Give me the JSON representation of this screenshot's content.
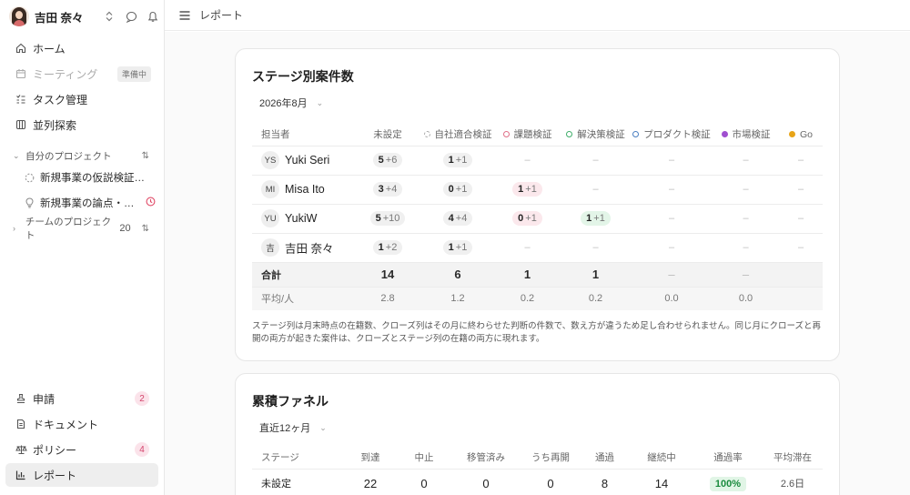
{
  "user": {
    "name": "吉田 奈々"
  },
  "nav": {
    "home": "ホーム",
    "meeting": "ミーティング",
    "meeting_badge": "準備中",
    "tasks": "タスク管理",
    "explore": "並列探索",
    "requests": "申請",
    "requests_count": "2",
    "documents": "ドキュメント",
    "policy": "ポリシー",
    "policy_count": "4",
    "reports": "レポート"
  },
  "my_projects": {
    "label": "自分のプロジェクト",
    "items": [
      "新規事業の仮説検証…",
      "新規事業の論点・…"
    ]
  },
  "team_projects": {
    "label": "チームのプロジェクト",
    "count": "20"
  },
  "topbar": {
    "title": "レポート"
  },
  "stage_card": {
    "title": "ステージ別案件数",
    "period": "2026年8月",
    "columns": [
      {
        "label": "担当者"
      },
      {
        "label": "未設定"
      },
      {
        "label": "自社適合検証",
        "dot": "#cccccc",
        "style": "dashed"
      },
      {
        "label": "課題検証",
        "dot": "#e07088",
        "style": "ring"
      },
      {
        "label": "解決策検証",
        "dot": "#3fae6a",
        "style": "ring"
      },
      {
        "label": "プロダクト検証",
        "dot": "#4a7fc1",
        "style": "ring"
      },
      {
        "label": "市場検証",
        "dot": "#a04fd0",
        "style": "fill"
      },
      {
        "label": "Go",
        "dot": "#e8a417",
        "style": "fill"
      }
    ],
    "rows": [
      {
        "initials": "YS",
        "name": "Yuki Seri",
        "cells": [
          [
            "5",
            "+6",
            ""
          ],
          [
            "1",
            "+1",
            ""
          ],
          null,
          null,
          null,
          null,
          null
        ]
      },
      {
        "initials": "MI",
        "name": "Misa Ito",
        "cells": [
          [
            "3",
            "+4",
            ""
          ],
          [
            "0",
            "+1",
            ""
          ],
          [
            "1",
            "+1",
            "red"
          ],
          null,
          null,
          null,
          null
        ]
      },
      {
        "initials": "YU",
        "name": "YukiW",
        "cells": [
          [
            "5",
            "+10",
            ""
          ],
          [
            "4",
            "+4",
            ""
          ],
          [
            "0",
            "+1",
            "red"
          ],
          [
            "1",
            "+1",
            "green"
          ],
          null,
          null,
          null
        ]
      },
      {
        "initials": "吉",
        "name": "吉田 奈々",
        "cells": [
          [
            "1",
            "+2",
            ""
          ],
          [
            "1",
            "+1",
            ""
          ],
          null,
          null,
          null,
          null,
          null
        ]
      }
    ],
    "total_label": "合計",
    "totals": [
      "14",
      "6",
      "1",
      "1",
      "–",
      "–",
      ""
    ],
    "avg_label": "平均/人",
    "avgs": [
      "2.8",
      "1.2",
      "0.2",
      "0.2",
      "0.0",
      "0.0",
      ""
    ],
    "dash": "–",
    "note": "ステージ列は月末時点の在籍数、クローズ列はその月に終わらせた判断の件数で、数え方が違うため足し合わせられません。同じ月にクローズと再開の両方が起きた案件は、クローズとステージ列の在籍の両方に現れます。"
  },
  "funnel_card": {
    "title": "累積ファネル",
    "period": "直近12ヶ月",
    "columns": [
      "ステージ",
      "到達",
      "中止",
      "移管済み",
      "うち再開",
      "通過",
      "継続中",
      "通過率",
      "平均滞在"
    ],
    "rows": [
      {
        "stage": "未設定",
        "values": [
          "22",
          "0",
          "0",
          "0",
          "8",
          "14"
        ],
        "rate": "100%",
        "stay": "2.6日"
      }
    ]
  }
}
